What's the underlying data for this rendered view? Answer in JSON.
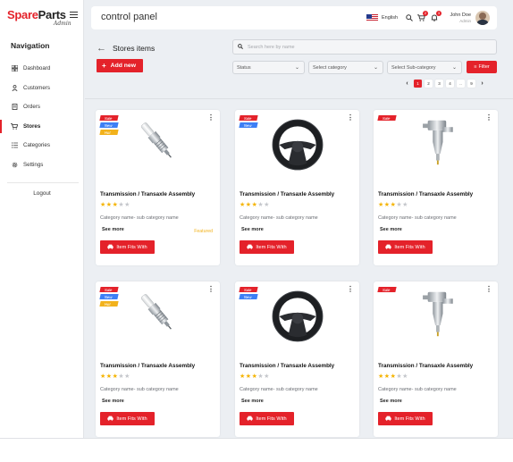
{
  "brand": {
    "name_part1": "Spare",
    "name_part2": "Parts",
    "sub": "Admin"
  },
  "sidebar": {
    "nav_title": "Navigation",
    "items": [
      {
        "label": "Dashboard",
        "icon": "grid-icon"
      },
      {
        "label": "Customers",
        "icon": "user-icon"
      },
      {
        "label": "Orders",
        "icon": "document-icon"
      },
      {
        "label": "Stores",
        "icon": "cart-icon",
        "active": true
      },
      {
        "label": "Categories",
        "icon": "list-icon"
      },
      {
        "label": "Settings",
        "icon": "gear-icon"
      }
    ],
    "logout": "Logout"
  },
  "topbar": {
    "title": "control panel",
    "language": "English",
    "cart_badge": "2",
    "notification_badge": "3",
    "user_name": "John Doe",
    "user_role": "Admin"
  },
  "header": {
    "title": "Stores items",
    "add_label": "Add new",
    "search_placeholder": "Search here by name",
    "filters": {
      "status": "Status",
      "category": "Select category",
      "subcategory": "Select Sub-category"
    },
    "filter_button": "Filter",
    "pagination": [
      "1",
      "2",
      "3",
      "4",
      "..",
      "9"
    ]
  },
  "accent_color": "#e4222a",
  "products": [
    {
      "name": "Transmission / Transaxle Assembly",
      "badges": [
        "Sale",
        "New",
        "Hot"
      ],
      "image": "spark-plug",
      "rating": 3,
      "category": "Category name- sub category name",
      "see_more": "See more",
      "featured": "Featured",
      "button": "Item Fits With"
    },
    {
      "name": "Transmission / Transaxle Assembly",
      "badges": [
        "Sale",
        "New"
      ],
      "image": "steering-wheel",
      "rating": 3,
      "category": "Category name- sub category name",
      "see_more": "See more",
      "featured": "",
      "button": "Item Fits With"
    },
    {
      "name": "Transmission / Transaxle Assembly",
      "badges": [
        "Sale"
      ],
      "image": "injector-part",
      "rating": 3,
      "category": "Category name- sub category name",
      "see_more": "See more",
      "featured": "",
      "button": "Item Fits With"
    },
    {
      "name": "Transmission / Transaxle Assembly",
      "badges": [
        "Sale",
        "New",
        "Hot"
      ],
      "image": "spark-plug",
      "rating": 3,
      "category": "Category name- sub category name",
      "see_more": "See more",
      "featured": "",
      "button": "Item Fits With"
    },
    {
      "name": "Transmission / Transaxle Assembly",
      "badges": [
        "Sale",
        "New"
      ],
      "image": "steering-wheel",
      "rating": 3,
      "category": "Category name- sub category name",
      "see_more": "See more",
      "featured": "",
      "button": "Item Fits With"
    },
    {
      "name": "Transmission / Transaxle Assembly",
      "badges": [
        "Sale"
      ],
      "image": "injector-part",
      "rating": 3,
      "category": "Category name- sub category name",
      "see_more": "See more",
      "featured": "",
      "button": "Item Fits With"
    }
  ]
}
